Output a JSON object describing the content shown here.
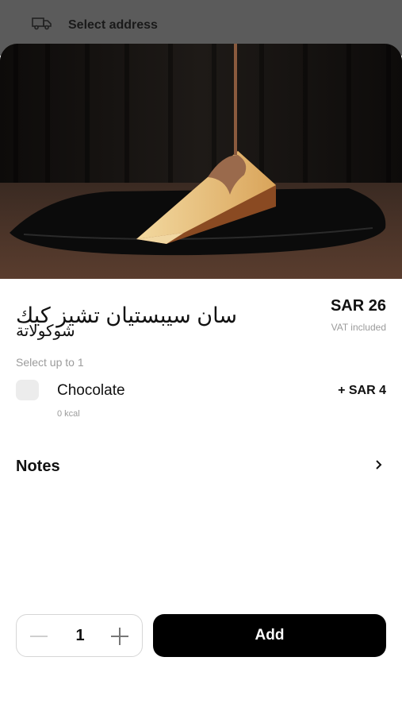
{
  "header": {
    "delivery_icon": "truck-icon",
    "address_label": "Select address"
  },
  "product": {
    "image": "cheesecake-photo",
    "title": "سان سيبستيان تشيز كيك",
    "price": "SAR 26",
    "vat_note": "VAT included"
  },
  "options": {
    "group_title": "شوكولاتة",
    "group_subtitle": "Select up to 1",
    "items": [
      {
        "label": "Chocolate",
        "price": "+ SAR 4",
        "kcal": "0 kcal",
        "checked": false
      }
    ]
  },
  "notes": {
    "label": "Notes",
    "chevron_icon": "chevron-right-icon"
  },
  "footer": {
    "quantity": "1",
    "minus_icon": "minus-icon",
    "plus_icon": "plus-icon",
    "add_label": "Add"
  },
  "colors": {
    "overlay": "#5b5b5b",
    "button_bg": "#000000",
    "checkbox_bg": "#ececec",
    "muted_text": "#9b9b9b"
  }
}
